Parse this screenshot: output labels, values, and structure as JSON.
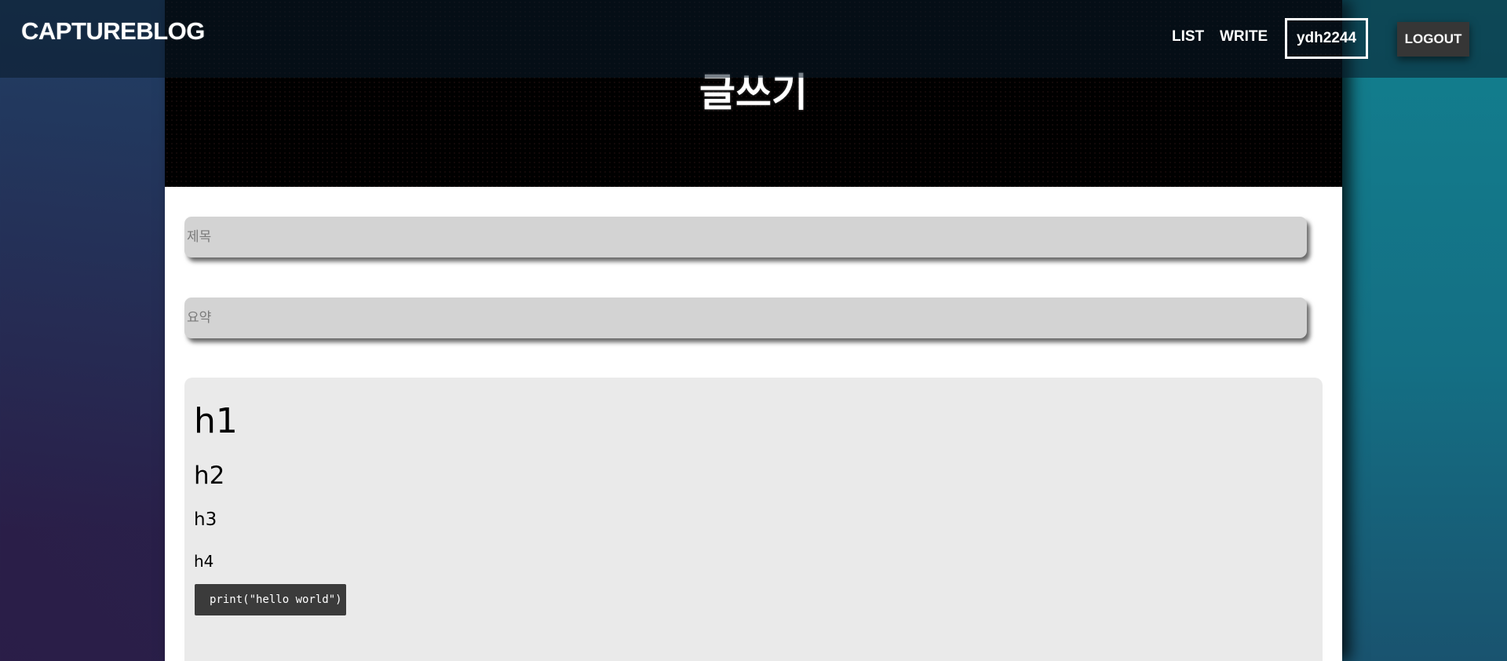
{
  "navbar": {
    "brand": "CAPTUREBLOG",
    "links": {
      "list": "LIST",
      "write": "WRITE"
    },
    "username": "ydh2244",
    "logout_label": "LOGOUT"
  },
  "hero": {
    "title": "글쓰기"
  },
  "form": {
    "title_placeholder": "제목",
    "summary_placeholder": "요약"
  },
  "editor": {
    "h1": "h1",
    "h2": "h2",
    "h3": "h3",
    "h4": "h4",
    "code": "print(\"hello world\")"
  }
}
